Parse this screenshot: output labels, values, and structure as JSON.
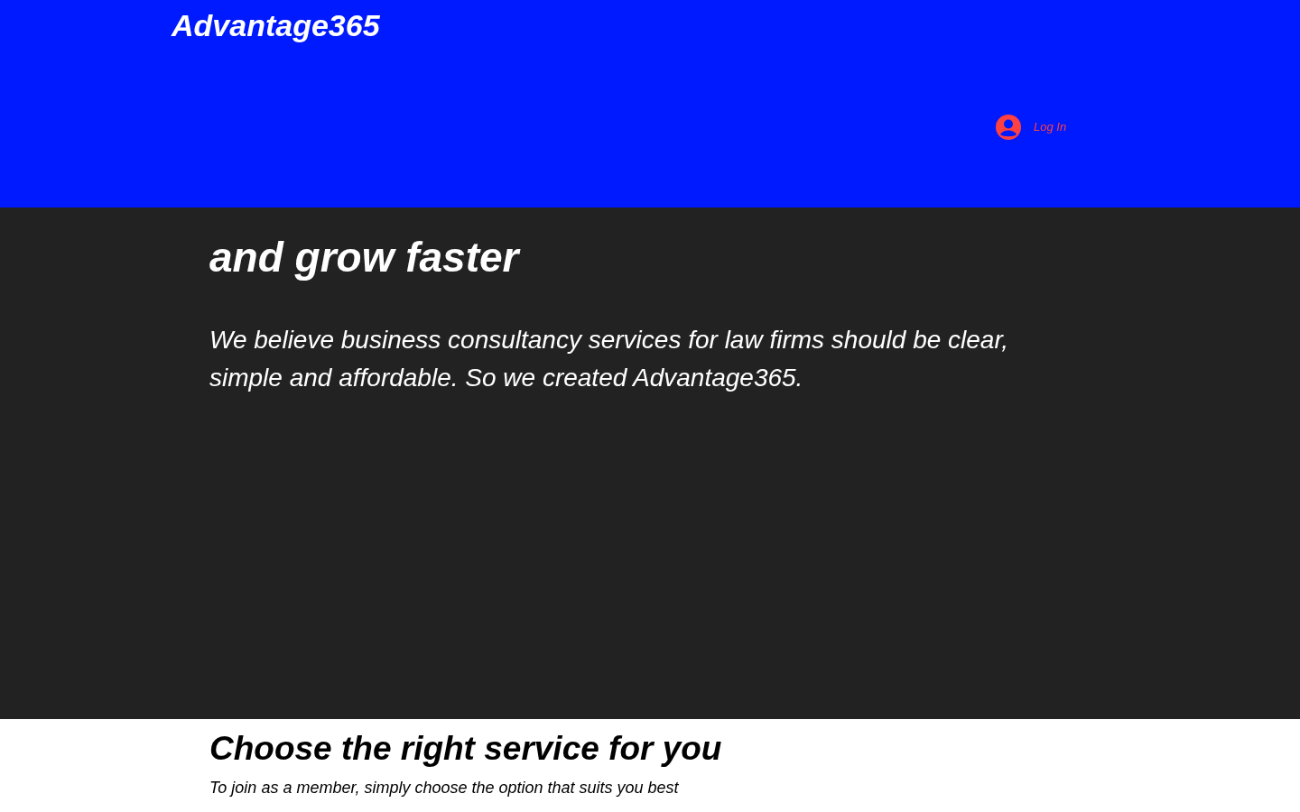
{
  "header": {
    "logo": "Advantage365",
    "login": {
      "label": "Log In"
    }
  },
  "hero": {
    "headline": [
      "and grow faster"
    ],
    "intro": "We believe business consultancy services for law firms should be clear, simple and affordable. So we created Advantage365."
  },
  "services": {
    "title": "Choose the right service for you",
    "subtitle": "To join as a member, simply choose the option that suits you best"
  }
}
